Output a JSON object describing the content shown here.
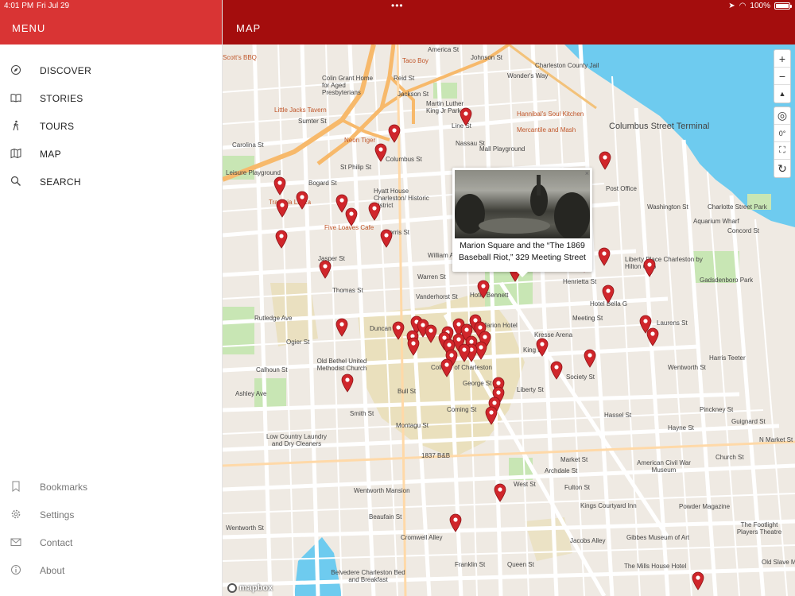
{
  "status": {
    "time": "4:01 PM",
    "date": "Fri Jul 29",
    "battery": "100%",
    "dots": "•••"
  },
  "sidebar": {
    "title": "MENU",
    "nav": [
      {
        "label": "DISCOVER",
        "icon": "compass-icon"
      },
      {
        "label": "STORIES",
        "icon": "book-icon"
      },
      {
        "label": "TOURS",
        "icon": "walking-person-icon"
      },
      {
        "label": "MAP",
        "icon": "map-icon"
      },
      {
        "label": "SEARCH",
        "icon": "search-icon"
      }
    ],
    "secondary": [
      {
        "label": "Bookmarks",
        "icon": "bookmark-icon"
      },
      {
        "label": "Settings",
        "icon": "gear-icon"
      },
      {
        "label": "Contact",
        "icon": "envelope-icon"
      },
      {
        "label": "About",
        "icon": "info-icon"
      }
    ]
  },
  "map_header": {
    "title": "MAP"
  },
  "map": {
    "controls": {
      "zoom_in": "+",
      "zoom_out": "−",
      "compass": "▲",
      "locate": "◎",
      "rotation": "0°",
      "fullscreen": "⛶",
      "refresh": "↻"
    },
    "popup": {
      "caption": "Marion Square and the “The 1869 Baseball Riot,” 329 Meeting Street",
      "close": "×"
    },
    "attribution": "mapbox",
    "colors": {
      "pin": "#d0262b",
      "water": "#6ecbef",
      "park": "#c8e6b4",
      "district": "#e8dcb0",
      "road_major": "#f7b96b"
    },
    "labels": [
      "Columbus Street Terminal",
      "Charleston County Jail",
      "Colin Grant Home for Aged Presbyterians",
      "Martin Luther King Jr Park",
      "Mall Playground",
      "Hannibal's Soul Kitchen",
      "Mercantile and Mash",
      "Hyatt House Charleston/ Historic District",
      "Post Office",
      "Charlotte Street Park",
      "Aquarium Wharf",
      "Liberty Place Charleston by Hilton Club",
      "Gadsdenboro Park",
      "Hotel Bennett",
      "Hotel Bella G",
      "Francis Marion Hotel",
      "Kresse Arena",
      "Harris Teeter",
      "Old Bethel United Methodist Church",
      "College of Charleston",
      "Low Country Laundry and Dry Cleaners",
      "1837 B&B",
      "American Civil War Museum",
      "Powder Magazine",
      "Kings Courtyard Inn",
      "Gibbes Museum of Art",
      "The Footlight Players Theatre",
      "The Mills House Hotel",
      "Old Slave Mart",
      "Wentworth Mansion",
      "Belvedere Charleston Bed and Breakfast",
      "Cromwell Alley",
      "Little Jacks Tavern",
      "Neon Tiger",
      "Taco Boy",
      "Scott's BBQ",
      "Five Loaves Cafe",
      "Trattoria Lucca",
      "Leisure Playground",
      "Reid St",
      "Jackson St",
      "Johnson St"
    ],
    "streets": [
      "Columbus St",
      "Sumter St",
      "Carolina St",
      "Bogard St",
      "Morris St",
      "Warren St",
      "Vanderhorst St",
      "Duncan St",
      "Calhoun St",
      "Bull St",
      "Montagu St",
      "Wentworth St",
      "Beaufain St",
      "Queen St",
      "Market St",
      "Hayne St",
      "Pinckney St",
      "Guignard St",
      "N Market St",
      "Hassel St",
      "Society St",
      "Laurens St",
      "Wentworth St",
      "Washington St",
      "Concord St",
      "King St",
      "Meeting St",
      "Coming St",
      "St Philip St",
      "Smith St",
      "Rutledge Ave",
      "Ashley Ave",
      "Ogier St",
      "Thomas St",
      "Jasper St",
      "Franklin St",
      "Archdale St",
      "Church St",
      "Fulton St",
      "West St",
      "Jacobs Alley",
      "George St",
      "Liberty St",
      "Henrietta St",
      "Line St",
      "Nassau St",
      "America St",
      "Wonder's Way",
      "William Aiken"
    ]
  }
}
